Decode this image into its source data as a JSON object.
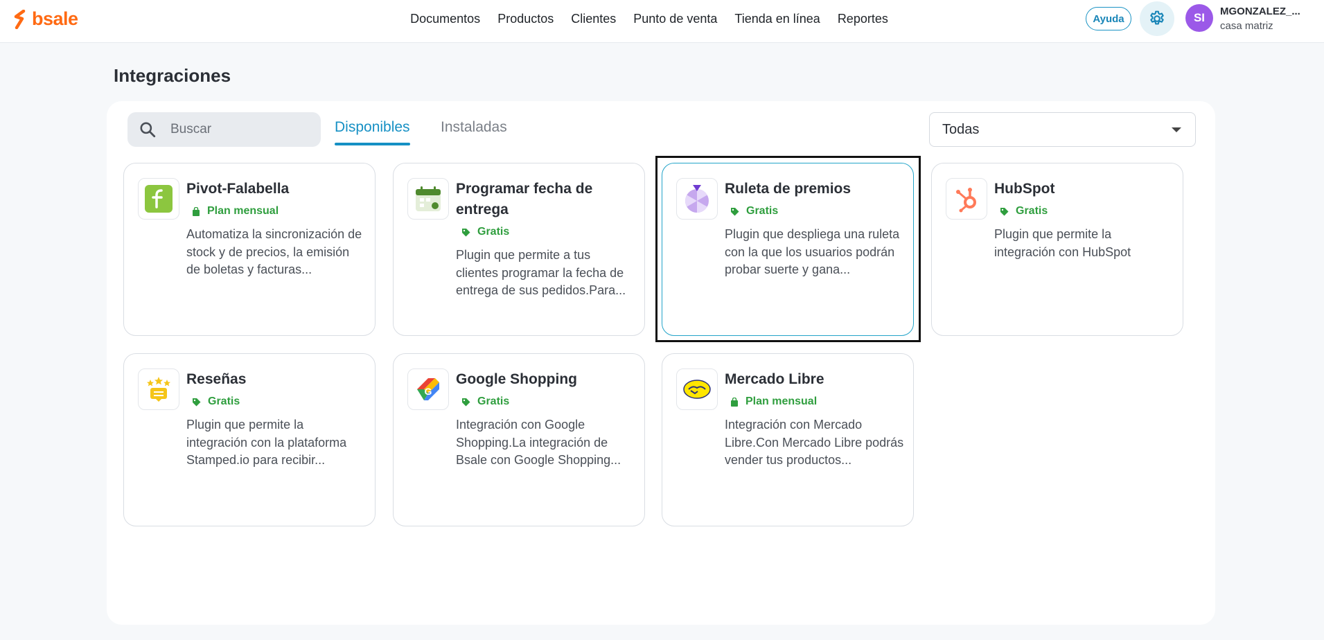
{
  "brand": {
    "name": "bsale",
    "color": "#ff6a13"
  },
  "nav": {
    "items": [
      {
        "label": "Documentos"
      },
      {
        "label": "Productos"
      },
      {
        "label": "Clientes"
      },
      {
        "label": "Punto de venta"
      },
      {
        "label": "Tienda en línea"
      },
      {
        "label": "Reportes"
      }
    ]
  },
  "header": {
    "help_label": "Ayuda",
    "settings_icon": "gear-icon",
    "user": {
      "initials": "SI",
      "name": "MGONZALEZ_...",
      "branch": "casa matriz"
    }
  },
  "page": {
    "title": "Integraciones"
  },
  "toolbar": {
    "search_placeholder": "Buscar",
    "search_value": "",
    "tabs": [
      {
        "label": "Disponibles",
        "active": true
      },
      {
        "label": "Instaladas",
        "active": false
      }
    ],
    "filter": {
      "selected": "Todas"
    }
  },
  "cards": [
    {
      "title": "Pivot-Falabella",
      "price": "Plan mensual",
      "price_icon": "bag-icon",
      "icon": "falabella-f-icon",
      "description": "Automatiza la sincronización de stock y de precios, la emisión de boletas y facturas..."
    },
    {
      "title": "Programar fecha de entrega",
      "price": "Gratis",
      "price_icon": "tag-icon",
      "icon": "calendar-icon",
      "description": "Plugin que permite a tus clientes programar la fecha de entrega de sus pedidos.Para..."
    },
    {
      "title": "Ruleta de premios",
      "price": "Gratis",
      "price_icon": "tag-icon",
      "icon": "prize-wheel-icon",
      "description": "Plugin que despliega una ruleta con la que los usuarios podrán probar suerte y gana..."
    },
    {
      "title": "HubSpot",
      "price": "Gratis",
      "price_icon": "tag-icon",
      "icon": "hubspot-icon",
      "description": "Plugin que permite la integración con HubSpot"
    },
    {
      "title": "Reseñas",
      "price": "Gratis",
      "price_icon": "tag-icon",
      "icon": "reviews-stars-icon",
      "description": "Plugin que permite la integración con la plataforma Stamped.io para recibir..."
    },
    {
      "title": "Google Shopping",
      "price": "Gratis",
      "price_icon": "tag-icon",
      "icon": "google-shopping-icon",
      "description": "Integración con Google Shopping.La integración de Bsale con Google Shopping..."
    },
    {
      "title": "Mercado Libre",
      "price": "Plan mensual",
      "price_icon": "bag-icon",
      "icon": "mercado-libre-icon",
      "description": "Integración con Mercado Libre.Con Mercado Libre podrás vender tus productos..."
    }
  ],
  "colors": {
    "accent": "#1690c4",
    "price_green": "#2f9e3e",
    "avatar": "#9b59e8",
    "hubspot": "#ff7a59",
    "falabella": "#8cc63f"
  }
}
